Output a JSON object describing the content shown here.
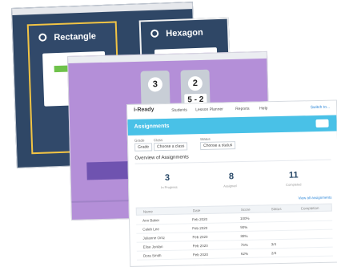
{
  "win1": {
    "panels": [
      {
        "title": "Rectangle"
      },
      {
        "title": "Hexagon"
      }
    ],
    "colors": {
      "background": "#2f4766",
      "highlight": "#f2c444",
      "green": "#6fc24b",
      "orange": "#f05a28"
    }
  },
  "win2": {
    "tiles": [
      {
        "number": "3"
      },
      {
        "number": "2",
        "expression": "5 - 2"
      }
    ],
    "colors": {
      "background": "#b48fd8",
      "accent": "#6f53b0"
    }
  },
  "win3": {
    "brand": "Ready",
    "nav": {
      "items": [
        "Students",
        "Lesson Planner",
        "Reports",
        "Help"
      ],
      "right_link": "Switch to..."
    },
    "hero": {
      "title": "Assignments"
    },
    "filters": [
      {
        "label": "Grade",
        "value": "Grade"
      },
      {
        "label": "Class",
        "value": "Choose a class"
      },
      {
        "label": "Status",
        "value": "Choose a status"
      }
    ],
    "section_title": "Overview of Assignments",
    "stats": [
      {
        "value": "3",
        "label": "In Progress"
      },
      {
        "value": "8",
        "label": "Assigned"
      },
      {
        "value": "11",
        "label": "Completed"
      }
    ],
    "link_right": "View all assignments",
    "table": {
      "headers": [
        "Name",
        "Date",
        "Score",
        "Status",
        "Completion"
      ],
      "rows": [
        {
          "name": "Ann Baker",
          "date": "Feb 2020",
          "score": "100%",
          "status": "",
          "completion": ""
        },
        {
          "name": "Caleb Lee",
          "date": "Feb 2020",
          "score": "90%",
          "status": "",
          "completion": ""
        },
        {
          "name": "Julianne Ortiz",
          "date": "Feb 2020",
          "score": "88%",
          "status": "",
          "completion": ""
        },
        {
          "name": "Elise Jordan",
          "date": "Feb 2020",
          "score": "76%",
          "status": "3/4",
          "completion": ""
        },
        {
          "name": "Dora Smith",
          "date": "Feb 2020",
          "score": "62%",
          "status": "2/4",
          "completion": ""
        }
      ]
    },
    "colors": {
      "hero": "#49c1e7",
      "link": "#2f88d9",
      "stat": "#2b4b6a"
    }
  }
}
